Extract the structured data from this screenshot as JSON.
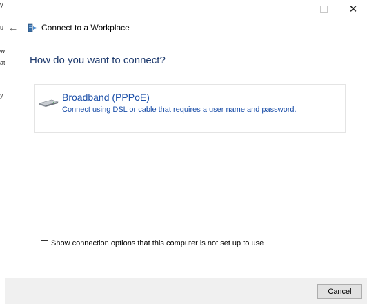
{
  "background_window": {
    "fragments": [
      "y",
      "u",
      "w",
      "at",
      "y"
    ]
  },
  "titlebar": {
    "minimize_glyph": "—",
    "maximize_glyph": "☐",
    "close_glyph": "✕"
  },
  "nav": {
    "back_glyph": "←",
    "title": "Connect to a Workplace"
  },
  "main": {
    "heading": "How do you want to connect?",
    "option": {
      "title": "Broadband (PPPoE)",
      "description": "Connect using DSL or cable that requires a user name and password."
    },
    "checkbox": {
      "label": "Show connection options that this computer is not set up to use",
      "checked": false
    }
  },
  "footer": {
    "cancel_label": "Cancel"
  },
  "colors": {
    "heading": "#1f3b6e",
    "link": "#1a4ea8",
    "footer_bg": "#f0f0f0"
  }
}
